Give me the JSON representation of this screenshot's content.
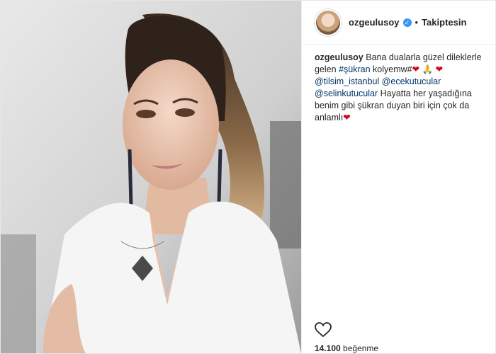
{
  "post": {
    "username": "ozgeulusoy",
    "follow_status": "Takiptesin",
    "separator": "•",
    "caption": {
      "author": "ozgeulusoy",
      "part1": " Bana dualarla güzel dileklerle gelen ",
      "hashtag": "#şükran",
      "part2": " kolyem",
      "part2b": "w#",
      "emoji1": "❤",
      "emoji2": "🙏",
      "emoji3": "❤",
      "mention1": "@tilsim_istanbul",
      "mention2": "@ecekutucular",
      "mention3": "@selinkutucular",
      "part3": " Hayatta her yaşadığına benim gibi şükran duyan biri için çok da anlamlı",
      "emoji4": "❤"
    },
    "likes_count": "14.100",
    "likes_label": "beğenme"
  },
  "icons": {
    "verified": "verified-badge-icon",
    "like": "heart-outline-icon"
  },
  "colors": {
    "link": "#003569",
    "verified": "#3897f0",
    "heart": "#d10a1e"
  }
}
